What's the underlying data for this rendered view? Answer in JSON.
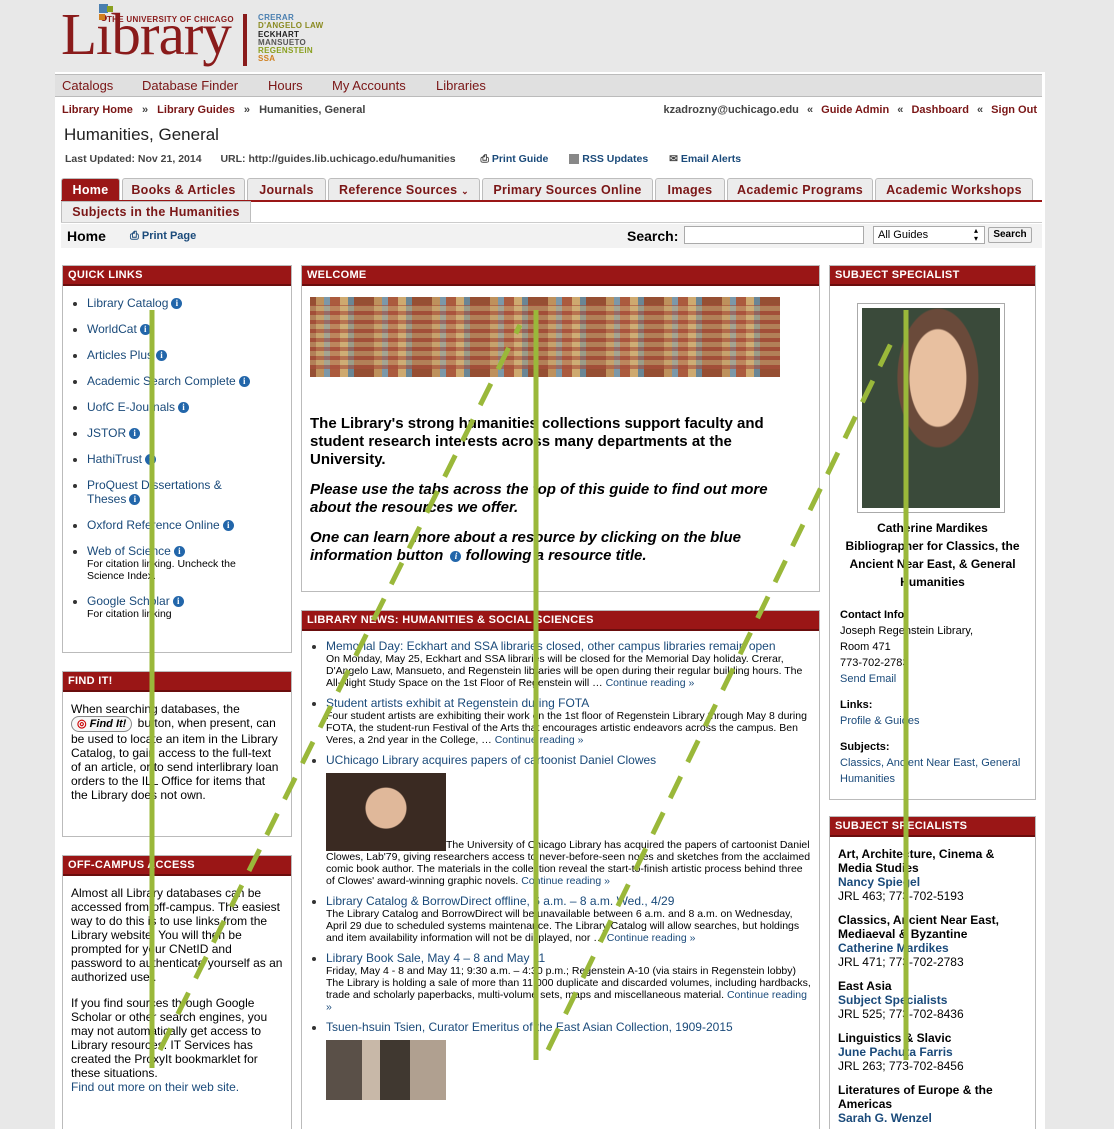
{
  "header": {
    "logo_word": "Library",
    "logo_sub": "THE UNIVERSITY OF CHICAGO",
    "libraries": [
      {
        "name": "CRERAR",
        "color": "#4a7fb0"
      },
      {
        "name": "D'ANGELO LAW",
        "color": "#8a8a20"
      },
      {
        "name": "ECKHART",
        "color": "#222222"
      },
      {
        "name": "MANSUETO",
        "color": "#555555"
      },
      {
        "name": "REGENSTEIN",
        "color": "#8aa020"
      },
      {
        "name": "SSA",
        "color": "#d08020"
      }
    ]
  },
  "topnav": [
    "Catalogs",
    "Database Finder",
    "Hours",
    "My Accounts",
    "Libraries"
  ],
  "breadcrumb": {
    "home": "Library Home",
    "guides": "Library Guides",
    "current": "Humanities, General",
    "sep": "»"
  },
  "user_nav": {
    "email": "kzadrozny@uchicago.edu",
    "sep": "«",
    "guide_admin": "Guide Admin",
    "dashboard": "Dashboard",
    "sign_out": "Sign Out"
  },
  "page_title": "Humanities, General",
  "meta": {
    "last_updated": "Last Updated: Nov 21, 2014",
    "url": "URL: http://guides.lib.uchicago.edu/humanities",
    "print_guide": "Print Guide",
    "rss": "RSS Updates",
    "email_alerts": "Email Alerts"
  },
  "tabs": [
    "Home",
    "Books & Articles",
    "Journals",
    "Reference Sources",
    "Primary Sources Online",
    "Images",
    "Academic Programs",
    "Academic Workshops",
    "Subjects in the Humanities"
  ],
  "subbar": {
    "home": "Home",
    "print_page": "Print Page",
    "search_label": "Search:",
    "scope": "All Guides",
    "search_button": "Search"
  },
  "quick_links": {
    "title": "QUICK LINKS",
    "items": [
      {
        "label": "Library Catalog",
        "note": ""
      },
      {
        "label": "WorldCat",
        "note": ""
      },
      {
        "label": "Articles Plus",
        "note": ""
      },
      {
        "label": "Academic Search Complete",
        "note": ""
      },
      {
        "label": "UofC E-Journals",
        "note": ""
      },
      {
        "label": "JSTOR",
        "note": ""
      },
      {
        "label": "HathiTrust",
        "note": ""
      },
      {
        "label": "ProQuest Dissertations & Theses",
        "note": ""
      },
      {
        "label": "Oxford Reference Online",
        "note": ""
      },
      {
        "label": "Web of Science",
        "note": "For citation linking. Uncheck the Science Index."
      },
      {
        "label": "Google Scholar",
        "note": "For citation linking"
      }
    ]
  },
  "find_it": {
    "title": "FIND IT!",
    "before": "When searching databases, the",
    "button": "Find It!",
    "after": "button, when present, can be used to locate an item in the Library Catalog, to gain access to the full-text of an article, or to send interlibrary loan orders to the ILL Office for items that the Library does not own."
  },
  "off_campus": {
    "title": "OFF-CAMPUS ACCESS",
    "p1": "Almost all Library databases can be accessed from off-campus. The easiest way to do this is to use links from the Library website. You will then be prompted for your CNetID and password to authenticate yourself as an authorized user.",
    "p2": "If you find sources through Google Scholar or other search engines, you may not automatically get access to Library resources. IT Services has created the ProxyIt bookmarklet for these situations.",
    "link": "Find out more on their web site."
  },
  "welcome": {
    "title": "WELCOME",
    "p1": "The Library's strong humanities collections support faculty and student research interests across many departments at the University.",
    "p2": "Please use the tabs across the top of this guide to find out more about the resources we offer.",
    "p3a": "One can learn more about a resource by clicking on the blue information button",
    "p3b": "following a resource title."
  },
  "news": {
    "title": "LIBRARY NEWS: HUMANITIES & SOCIAL SCIENCES",
    "more": "Continue reading »",
    "items": [
      {
        "title": "Memorial Day: Eckhart and SSA libraries closed, other campus libraries remain open",
        "body": "On Monday, May 25, Eckhart and SSA libraries will be closed for the Memorial Day holiday. Crerar, D'Angelo Law, Mansueto, and Regenstein libraries will be open during their regular building hours. The All-Night Study Space on the 1st Floor of Regenstein will …"
      },
      {
        "title": "Student artists exhibit at Regenstein during FOTA",
        "body": "Four student artists are exhibiting their work on the 1st floor of Regenstein Library through May 8 during FOTA, the student-run Festival of the Arts that encourages artistic endeavors across the campus.  Ben Veres, a 2nd year in the College, …"
      },
      {
        "title": "UChicago Library acquires papers of cartoonist Daniel Clowes",
        "body": "The University of Chicago Library has acquired the papers of cartoonist Daniel Clowes, Lab'79, giving researchers access to never-before-seen notes and sketches from the acclaimed comic book author. The materials in the collection reveal the start-to-finish artistic process behind three of Clowes' award-winning graphic novels."
      },
      {
        "title": "Library Catalog & BorrowDirect offline, 6 a.m. – 8 a.m. Wed., 4/29",
        "body": "The Library Catalog and BorrowDirect will be unavailable between 6 a.m. and 8 a.m. on Wednesday, April 29 due to scheduled systems maintenance. The Library Catalog will allow searches, but holdings and item availability information will not be displayed, nor …"
      },
      {
        "title": "Library Book Sale, May 4 – 8 and May 11",
        "body": "Friday, May 4 - 8 and May 11; 9:30 a.m. – 4:30 p.m.; Regenstein A-10 (via stairs in Regenstein lobby) The Library is holding a sale of more than 11,000 duplicate and discarded volumes, including hardbacks, trade and scholarly paperbacks, multi-volume sets, maps and miscellaneous material."
      },
      {
        "title": "Tsuen-hsuin Tsien, Curator Emeritus of the East Asian Collection, 1909-2015",
        "body": ""
      }
    ]
  },
  "specialist": {
    "title": "SUBJECT SPECIALIST",
    "name": "Catherine Mardikes",
    "role": "Bibliographer for Classics, the Ancient Near East, & General Humanities",
    "contact_label": "Contact Info",
    "contact": [
      "Joseph Regenstein Library,",
      "Room 471",
      "773-702-2783"
    ],
    "send_email": "Send Email",
    "links_label": "Links:",
    "profile": "Profile & Guides",
    "subjects_label": "Subjects:",
    "subjects": "Classics, Ancient Near East, General Humanities"
  },
  "specialists": {
    "title": "SUBJECT SPECIALISTS",
    "items": [
      {
        "subject": "Art, Architecture, Cinema & Media Studies",
        "person": "Nancy Spiegel",
        "info": "JRL 463; 773-702-5193"
      },
      {
        "subject": "Classics, Ancient Near East, Mediaeval & Byzantine",
        "person": "Catherine Mardikes",
        "info": "JRL 471; 773-702-2783"
      },
      {
        "subject": "East Asia",
        "person": "Subject Specialists",
        "info": "JRL 525; 773-702-8436"
      },
      {
        "subject": "Linguistics & Slavic",
        "person": "June Pachuta Farris",
        "info": "JRL 263; 773-702-8456"
      },
      {
        "subject": "Literatures of Europe & the Americas",
        "person": "Sarah G. Wenzel",
        "info": ""
      }
    ]
  },
  "colors": {
    "brand": "#8a1b1b",
    "header_bar": "#9a1616",
    "link": "#1a4a7a",
    "overlay": "#9ab83a"
  }
}
